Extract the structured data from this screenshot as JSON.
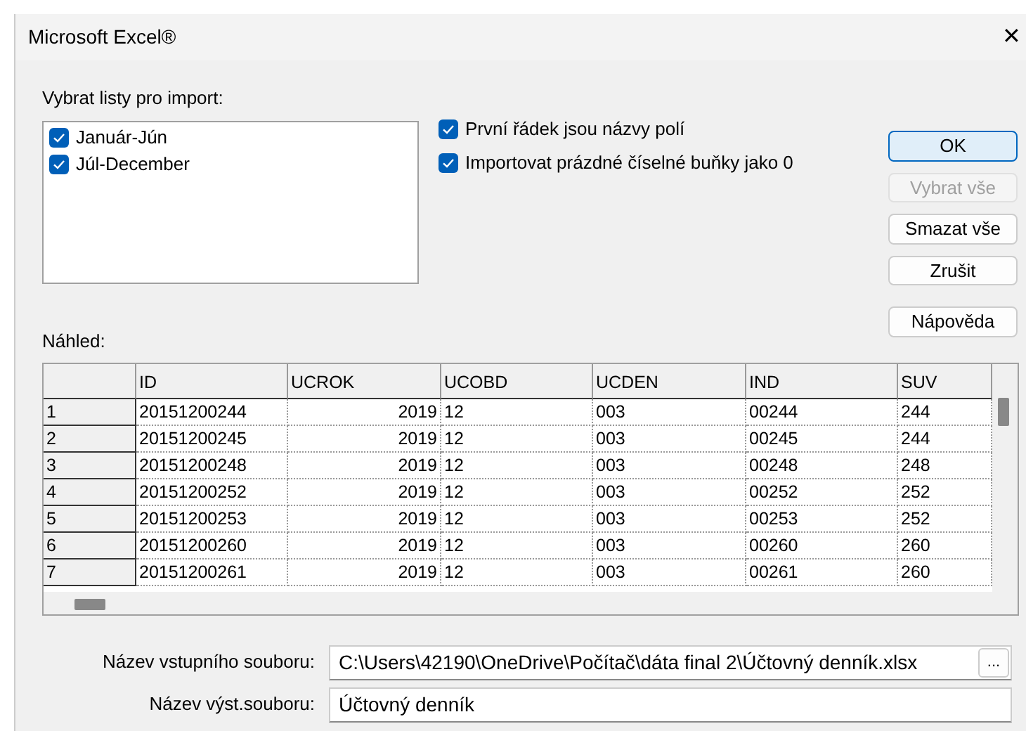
{
  "window": {
    "title": "Microsoft Excel®",
    "close": "✕"
  },
  "sheets": {
    "label": "Vybrat listy pro import:",
    "items": [
      {
        "label": "Január-Jún",
        "checked": true
      },
      {
        "label": "Júl-December",
        "checked": true
      }
    ]
  },
  "options": [
    {
      "label": "První řádek jsou názvy polí",
      "checked": true
    },
    {
      "label": "Importovat prázdné číselné buňky jako 0",
      "checked": true
    }
  ],
  "buttons": [
    {
      "label": "OK",
      "default": true,
      "disabled": false
    },
    {
      "label": "Vybrat vše",
      "default": false,
      "disabled": true
    },
    {
      "label": "Smazat vše",
      "default": false,
      "disabled": false
    },
    {
      "label": "Zrušit",
      "default": false,
      "disabled": false
    },
    {
      "label": "Nápověda",
      "default": false,
      "disabled": false
    }
  ],
  "preview": {
    "label": "Náhled:",
    "columns": [
      {
        "label": "ID",
        "numeric": false
      },
      {
        "label": "UCROK",
        "numeric": true
      },
      {
        "label": "UCOBD",
        "numeric": false
      },
      {
        "label": "UCDEN",
        "numeric": false
      },
      {
        "label": "IND",
        "numeric": false
      },
      {
        "label": "SUV",
        "numeric": false
      }
    ],
    "rows": [
      {
        "number": "1",
        "cells": [
          "20151200244",
          "2019",
          "12",
          "003",
          "00244",
          "244"
        ]
      },
      {
        "number": "2",
        "cells": [
          "20151200245",
          "2019",
          "12",
          "003",
          "00245",
          "244"
        ]
      },
      {
        "number": "3",
        "cells": [
          "20151200248",
          "2019",
          "12",
          "003",
          "00248",
          "248"
        ]
      },
      {
        "number": "4",
        "cells": [
          "20151200252",
          "2019",
          "12",
          "003",
          "00252",
          "252"
        ]
      },
      {
        "number": "5",
        "cells": [
          "20151200253",
          "2019",
          "12",
          "003",
          "00253",
          "252"
        ]
      },
      {
        "number": "6",
        "cells": [
          "20151200260",
          "2019",
          "12",
          "003",
          "00260",
          "260"
        ]
      },
      {
        "number": "7",
        "cells": [
          "20151200261",
          "2019",
          "12",
          "003",
          "00261",
          "260"
        ]
      }
    ]
  },
  "input_file": {
    "label": "Název vstupního souboru:",
    "value": "C:\\Users\\42190\\OneDrive\\Počítač\\dáta final 2\\Účtovný denník.xlsx",
    "browse": "..."
  },
  "output_file": {
    "label": "Název výst.souboru:",
    "value": "Účtovný denník"
  }
}
